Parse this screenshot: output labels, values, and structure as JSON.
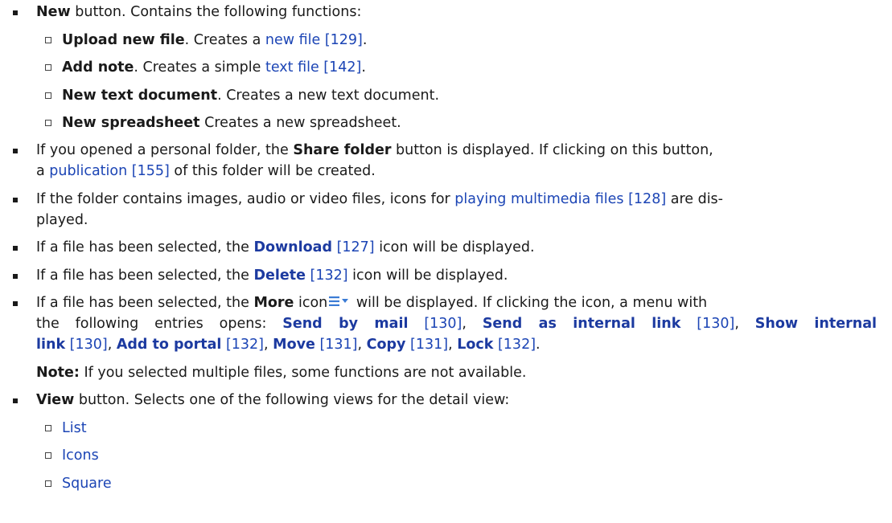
{
  "items": {
    "new": {
      "bold": "New",
      "rest": " button. Contains the following functions:",
      "subs": [
        {
          "bold": "Upload new file",
          "mid": ". Creates a ",
          "link": "new file [129]",
          "end": "."
        },
        {
          "bold": "Add note",
          "mid": ". Creates a simple ",
          "link": "text file [142]",
          "end": "."
        },
        {
          "bold": "New text document",
          "mid": ". Creates a new text document.",
          "link": "",
          "end": ""
        },
        {
          "bold": "New spreadsheet",
          "mid": " Creates a new spreadsheet.",
          "link": "",
          "end": ""
        }
      ]
    },
    "share": {
      "pre": "If you opened a personal folder, the ",
      "bold": "Share folder",
      "post": " button is displayed. If clicking on this button,",
      "l2a": "a ",
      "link": "publication [155]",
      "l2b": " of this folder will be created."
    },
    "media": {
      "pre": "If the folder contains images, audio or video files, icons for ",
      "link": "playing multimedia files [128]",
      "post": " are dis-",
      "l2": "played."
    },
    "download": {
      "pre": "If a file has been selected, the ",
      "bold": "Download",
      "ref": " [127]",
      "post": " icon will be displayed."
    },
    "delete": {
      "pre": "If a file has been selected, the ",
      "bold": "Delete",
      "ref": " [132]",
      "post": " icon will be displayed."
    },
    "more": {
      "pre": "If a file has been selected, the ",
      "bold": "More",
      "icon_word": " icon",
      "icon": "hamburger-menu-dropdown-icon",
      "post": " will be displayed. If clicking the icon, a menu with",
      "l2pre": "the following entries opens: ",
      "e1": "Send by mail",
      "r1": " [130]",
      "s1": ", ",
      "e2": "Send as internal link",
      "r2": " [130]",
      "s2": ", ",
      "e3a": "Show internal",
      "e3b": "link",
      "r3": " [130]",
      "s3": ", ",
      "e4": "Add to portal",
      "r4": " [132]",
      "s4": ", ",
      "e5": "Move",
      "r5": " [131]",
      "s5": ", ",
      "e6": "Copy",
      "r6": " [131]",
      "s6": ", ",
      "e7": "Lock",
      "r7": " [132]",
      "s7": ".",
      "note_bold": "Note:",
      "note_rest": " If you selected multiple files, some functions are not available."
    },
    "view": {
      "bold": "View",
      "rest": " button. Selects one of the following views for the detail view:",
      "subs": [
        "List",
        "Icons",
        "Square"
      ]
    }
  },
  "colors": {
    "link": "#1c45b5",
    "text": "#1a1a1a"
  }
}
